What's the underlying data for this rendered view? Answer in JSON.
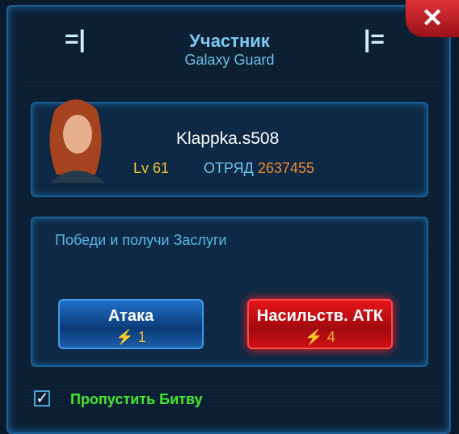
{
  "header": {
    "title": "Участник",
    "subtitle": "Galaxy Guard",
    "close_icon": "close-icon"
  },
  "player": {
    "name": "Klappka.s508",
    "level": "Lv 61",
    "squad_label": "ОТРЯД",
    "squad_value": "2637455"
  },
  "battle": {
    "hint": "Победи и получи Заслуги",
    "attack": {
      "label": "Атака",
      "cost": "1"
    },
    "force_attack": {
      "label": "Насильств. АТК",
      "cost": "4"
    }
  },
  "skip": {
    "label": "Пропустить Битву",
    "checked": true
  },
  "colors": {
    "attack": "#1d6fc8",
    "force_attack": "#e8141a",
    "skip": "#44e830",
    "accent": "#7ccaf2"
  }
}
